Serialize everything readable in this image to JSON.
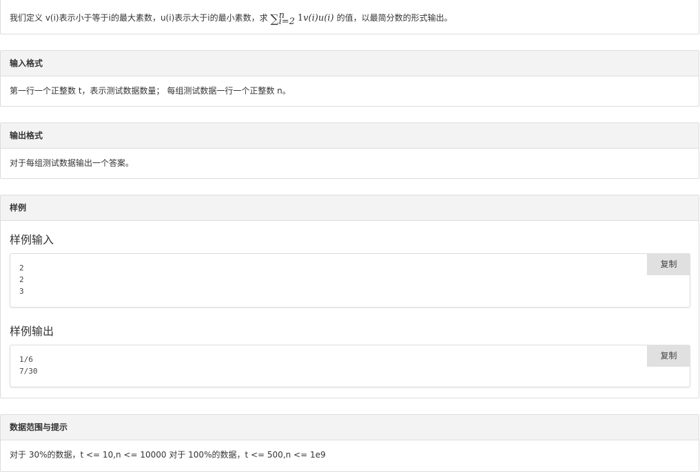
{
  "description": {
    "prefix": "我们定义 v(i)表示小于等于i的最大素数，u(i)表示大于i的最小素数，求",
    "formula": {
      "symbol": "∑",
      "upper": "n",
      "lower": "i=2",
      "body_lead": "1",
      "body_v": "v",
      "body_arg1": "(i)",
      "body_u": "u",
      "body_arg2": "(i)"
    },
    "suffix": "的值，以最简分数的形式输出。"
  },
  "input_format": {
    "title": "输入格式",
    "text": "第一行一个正整数 t，表示测试数据数量； 每组测试数据一行一个正整数 n。"
  },
  "output_format": {
    "title": "输出格式",
    "text": "对于每组测试数据输出一个答案。"
  },
  "samples": {
    "title": "样例",
    "input_title": "样例输入",
    "input_content": "2\n2\n3",
    "output_title": "样例输出",
    "output_content": "1/6\n7/30",
    "copy_label": "复制"
  },
  "hints": {
    "title": "数据范围与提示",
    "text": "对于 30%的数据，t <= 10,n <= 10000 对于 100%的数据，t <= 500,n <= 1e9"
  }
}
